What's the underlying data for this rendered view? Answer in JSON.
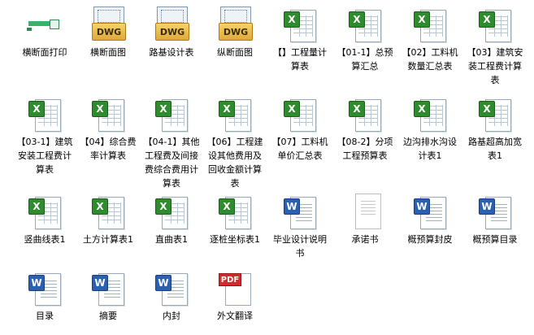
{
  "files": [
    {
      "name": "横断面打印",
      "type": "prt"
    },
    {
      "name": "横断面图",
      "type": "dwg"
    },
    {
      "name": "路基设计表",
      "type": "dwg"
    },
    {
      "name": "纵断面图",
      "type": "dwg"
    },
    {
      "name": "【】工程量计算表",
      "type": "xls"
    },
    {
      "name": "【01-1】总预算汇总",
      "type": "xls"
    },
    {
      "name": "【02】工料机数量汇总表",
      "type": "xls"
    },
    {
      "name": "【03】建筑安装工程费计算表",
      "type": "xls"
    },
    {
      "name": "【03-1】建筑安装工程费计算表",
      "type": "xls"
    },
    {
      "name": "【04】综合费率计算表",
      "type": "xls"
    },
    {
      "name": "【04-1】其他工程费及间接费综合费用计算表",
      "type": "xls"
    },
    {
      "name": "【06】工程建设其他费用及回收金额计算表",
      "type": "xls"
    },
    {
      "name": "【07】工料机单价汇总表",
      "type": "xls"
    },
    {
      "name": "【08-2】分项工程预算表",
      "type": "xls"
    },
    {
      "name": "边沟排水沟设计表1",
      "type": "xls"
    },
    {
      "name": "路基超高加宽表1",
      "type": "xls"
    },
    {
      "name": "竖曲线表1",
      "type": "xls"
    },
    {
      "name": "土方计算表1",
      "type": "xls"
    },
    {
      "name": "直曲表1",
      "type": "xls"
    },
    {
      "name": "逐桩坐标表1",
      "type": "xls"
    },
    {
      "name": "毕业设计说明书",
      "type": "doc"
    },
    {
      "name": "承诺书",
      "type": "scan"
    },
    {
      "name": "概预算封皮",
      "type": "doc"
    },
    {
      "name": "概预算目录",
      "type": "doc"
    },
    {
      "name": "目录",
      "type": "doc"
    },
    {
      "name": "摘要",
      "type": "doc"
    },
    {
      "name": "内封",
      "type": "doc"
    },
    {
      "name": "外文翻译",
      "type": "pdf"
    }
  ],
  "badges": {
    "xls": "X",
    "doc": "W",
    "dwg": "DWG",
    "pdf": "PDF"
  }
}
